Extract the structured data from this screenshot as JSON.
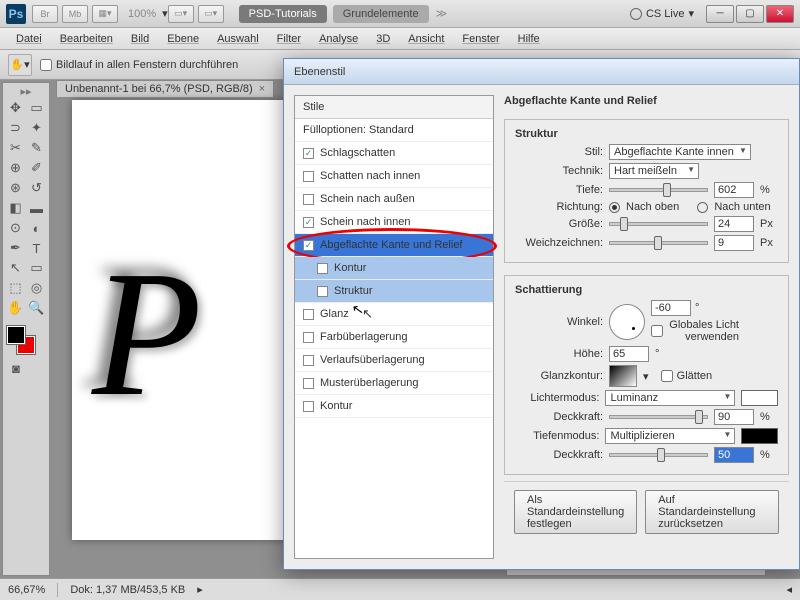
{
  "app": {
    "initials": "Ps",
    "zoom": "100%"
  },
  "workspace": {
    "btns": [
      "Br",
      "Mb"
    ],
    "tabs": [
      "PSD-Tutorials",
      "Grundelemente"
    ],
    "cslive": "CS Live"
  },
  "menu": [
    "Datei",
    "Bearbeiten",
    "Bild",
    "Ebene",
    "Auswahl",
    "Filter",
    "Analyse",
    "3D",
    "Ansicht",
    "Fenster",
    "Hilfe"
  ],
  "options": {
    "scroll_all": "Bildlauf in allen Fenstern durchführen"
  },
  "document": {
    "tab": "Unbenannt-1 bei 66,7% (PSD, RGB/8)",
    "letter": "P"
  },
  "statusbar": {
    "zoom": "66,67%",
    "info": "Dok: 1,37 MB/453,5 KB"
  },
  "dialog": {
    "title": "Ebenenstil",
    "styles_header": "Stile",
    "blend_header": "Fülloptionen: Standard",
    "styles": [
      {
        "label": "Schlagschatten",
        "checked": true
      },
      {
        "label": "Schatten nach innen",
        "checked": false
      },
      {
        "label": "Schein nach außen",
        "checked": false
      },
      {
        "label": "Schein nach innen",
        "checked": true
      },
      {
        "label": "Abgeflachte Kante und Relief",
        "checked": true,
        "selected": true,
        "highlight": true
      },
      {
        "label": "Kontur",
        "checked": false,
        "sub": true
      },
      {
        "label": "Struktur",
        "checked": false,
        "sub": true
      },
      {
        "label": "Glanz",
        "checked": false,
        "cursor": true
      },
      {
        "label": "Farbüberlagerung",
        "checked": false
      },
      {
        "label": "Verlaufsüberlagerung",
        "checked": false
      },
      {
        "label": "Musterüberlagerung",
        "checked": false
      },
      {
        "label": "Kontur",
        "checked": false
      }
    ],
    "panel_title": "Abgeflachte Kante und Relief",
    "structure": {
      "title": "Struktur",
      "style_label": "Stil:",
      "style_value": "Abgeflachte Kante innen",
      "tech_label": "Technik:",
      "tech_value": "Hart meißeln",
      "depth_label": "Tiefe:",
      "depth_value": "602",
      "depth_unit": "%",
      "dir_label": "Richtung:",
      "dir_up": "Nach oben",
      "dir_down": "Nach unten",
      "size_label": "Größe:",
      "size_value": "24",
      "size_unit": "Px",
      "soften_label": "Weichzeichnen:",
      "soften_value": "9",
      "soften_unit": "Px"
    },
    "shading": {
      "title": "Schattierung",
      "angle_label": "Winkel:",
      "angle_value": "-60",
      "global_light": "Globales Licht verwenden",
      "alt_label": "Höhe:",
      "alt_value": "65",
      "gloss_label": "Glanzkontur:",
      "aa": "Glätten",
      "hl_mode_label": "Lichtermodus:",
      "hl_mode": "Luminanz",
      "hl_color": "#ffffff",
      "hl_op_label": "Deckkraft:",
      "hl_op": "90",
      "sh_mode_label": "Tiefenmodus:",
      "sh_mode": "Multiplizieren",
      "sh_color": "#000000",
      "sh_op_label": "Deckkraft:",
      "sh_op": "50"
    },
    "buttons": {
      "default": "Als Standardeinstellung festlegen",
      "reset": "Auf Standardeinstellung zurücksetzen"
    }
  }
}
